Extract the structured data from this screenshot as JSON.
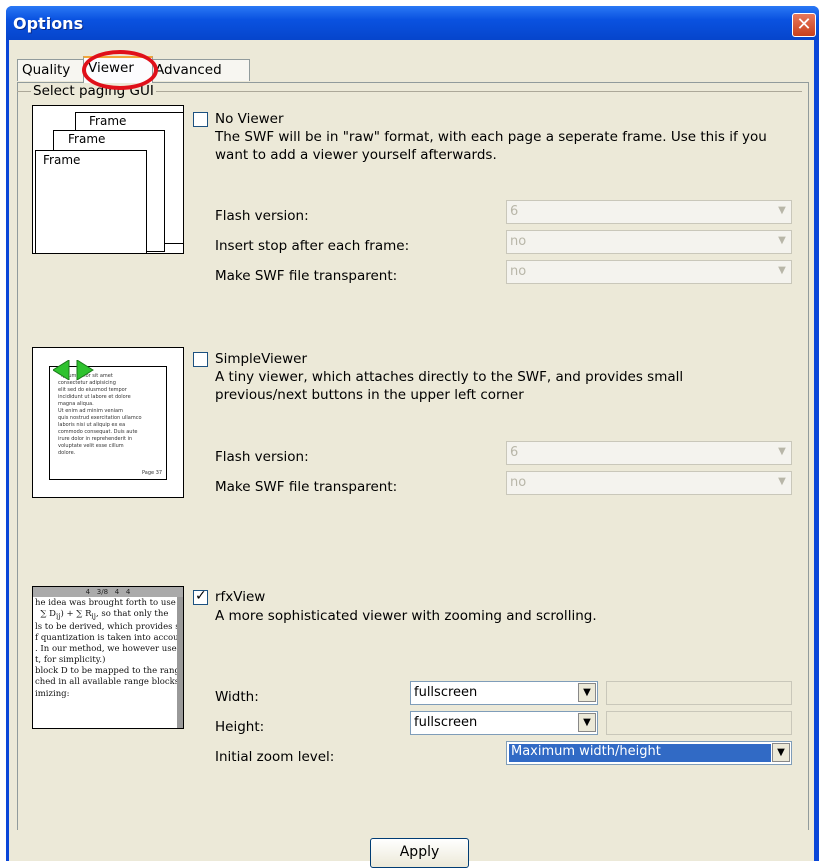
{
  "window": {
    "title": "Options",
    "close_glyph": "✕"
  },
  "tabs": [
    {
      "label": "Quality"
    },
    {
      "label": "Viewer",
      "active": true
    },
    {
      "label": "Advanced"
    }
  ],
  "group": {
    "label": "Select paging GUI"
  },
  "no_viewer": {
    "frame_labels": [
      "Frame",
      "Frame",
      "Frame"
    ],
    "checkbox_label": "No Viewer",
    "checked": false,
    "description_line1": "The SWF will be in \"raw\" format, with each page a seperate frame. Use this if you",
    "description_line2": "want to add a viewer yourself afterwards.",
    "fields": [
      {
        "label": "Flash version:",
        "value": "6"
      },
      {
        "label": "Insert stop after each frame:",
        "value": "no"
      },
      {
        "label": "Make SWF file transparent:",
        "value": "no"
      }
    ]
  },
  "simple_viewer": {
    "checkbox_label": "SimpleViewer",
    "checked": false,
    "description_line1": "A tiny viewer, which attaches directly to the SWF, and provides small",
    "description_line2": "previous/next buttons in the upper left corner",
    "fields": [
      {
        "label": "Flash version:",
        "value": "6"
      },
      {
        "label": "Make SWF file transparent:",
        "value": "no"
      }
    ],
    "thumb_page_label": "Page 37"
  },
  "rfx_view": {
    "checkbox_label": "rfxView",
    "checked": true,
    "description": "A more sophisticated viewer with zooming and scrolling.",
    "width_label": "Width:",
    "width_value": "fullscreen",
    "height_label": "Height:",
    "height_value": "fullscreen",
    "zoom_label": "Initial zoom level:",
    "zoom_value": "Maximum width/height",
    "thumb_toolbar": "4   3/8   4   4"
  },
  "apply_label": "Apply"
}
